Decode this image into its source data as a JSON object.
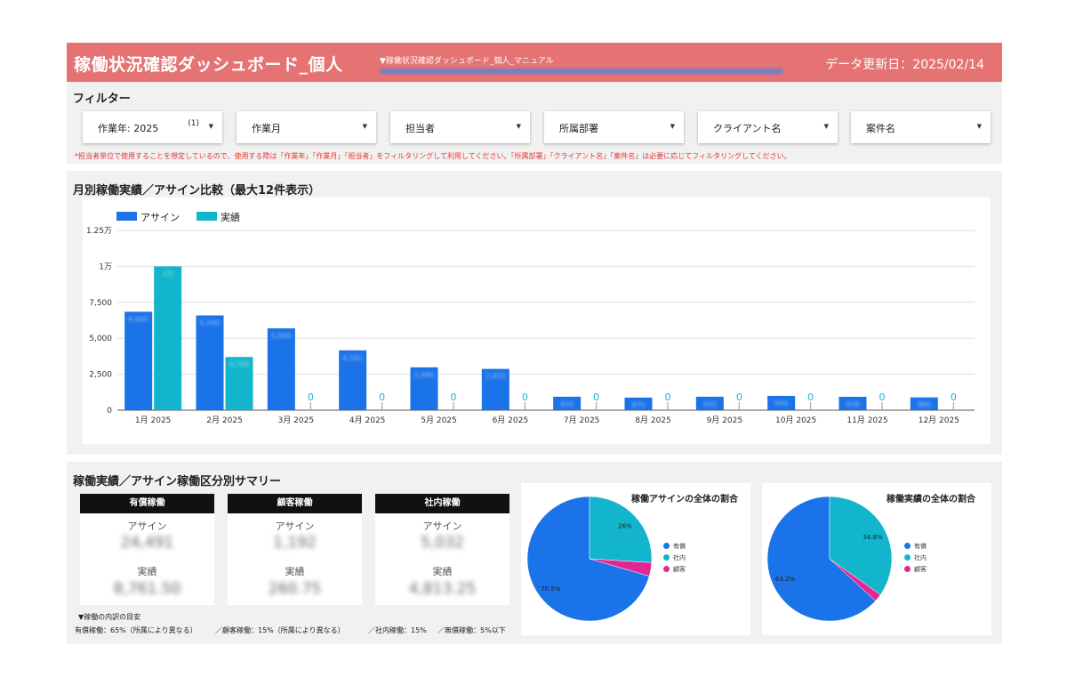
{
  "header": {
    "title": "稼働状況確認ダッシュボード_個人",
    "manual_label": "▼稼働状況確認ダッシュボード_個人_マニュアル",
    "update_date": "データ更新日：2025/02/14"
  },
  "filters": {
    "title": "フィルター",
    "items": [
      {
        "label": "作業年: 2025",
        "count": "(1)"
      },
      {
        "label": "作業月",
        "count": ""
      },
      {
        "label": "担当者",
        "count": ""
      },
      {
        "label": "所属部署",
        "count": ""
      },
      {
        "label": "クライアント名",
        "count": ""
      },
      {
        "label": "案件名",
        "count": ""
      }
    ],
    "notice": "*担当者単位で使用することを想定しているので、使用する際は「作業年」「作業月」「担当者」をフィルタリングして利用してください。「所属部署」「クライアント名」「案件名」は必要に応じてフィルタリングしてください。"
  },
  "bar_section_title": "月別稼働実績／アサイン比較（最大12件表示）",
  "summary_section_title": "稼働実績／アサイン稼働区分別サマリー",
  "kpis": [
    {
      "title": "有償稼働",
      "assign_label": "アサイン",
      "assign_value": "24,491",
      "actual_label": "実績",
      "actual_value": "8,761.50"
    },
    {
      "title": "顧客稼働",
      "assign_label": "アサイン",
      "assign_value": "1,192",
      "actual_label": "実績",
      "actual_value": "260.75"
    },
    {
      "title": "社内稼働",
      "assign_label": "アサイン",
      "assign_value": "5,032",
      "actual_label": "実績",
      "actual_value": "4,813.25"
    }
  ],
  "notes": {
    "title": "▼稼働の内訳の目安",
    "paid": "有償稼働：65%（所属により異なる）",
    "client": "／顧客稼働：15%（所属により異なる）",
    "internal": "／社内稼働：15%",
    "unpaid": "／無償稼働：5%以下"
  },
  "colors": {
    "header_bg": "#e57373",
    "assign": "#1a73e8",
    "actual": "#12b5cb",
    "client": "#e52592",
    "notice": "#e53935"
  },
  "chart_data": [
    {
      "type": "bar",
      "categories": [
        "1月 2025",
        "2月 2025",
        "3月 2025",
        "4月 2025",
        "5月 2025",
        "6月 2025",
        "7月 2025",
        "8月 2025",
        "9月 2025",
        "10月 2025",
        "11月 2025",
        "12月 2025"
      ],
      "series": [
        {
          "name": "アサイン",
          "values": [
            6845,
            6590,
            5690,
            4161,
            2980,
            2870,
            935,
            875,
            935,
            994,
            929,
            889
          ]
        },
        {
          "name": "実績",
          "values": [
            10000,
            3700,
            0,
            0,
            0,
            0,
            0,
            0,
            0,
            0,
            0,
            0
          ]
        }
      ],
      "value_labels": [
        [
          "6,845",
          "6,590",
          "5,690",
          "4,161",
          "2,980",
          "2,870",
          "935",
          "875",
          "935",
          "994",
          "929",
          "889"
        ],
        [
          "1万",
          "3,700",
          "0",
          "0",
          "0",
          "0",
          "0",
          "0",
          "0",
          "0",
          "0",
          "0"
        ]
      ],
      "ylim": [
        0,
        12500
      ],
      "yticks": [
        0,
        2500,
        5000,
        7500,
        10000,
        12500
      ],
      "ytick_labels": [
        "0",
        "2,500",
        "5,000",
        "7,500",
        "1万",
        "1.25万"
      ],
      "legend_position": "top-left",
      "grid": true
    },
    {
      "type": "pie",
      "title": "稼働アサインの全体の割合",
      "labels": [
        "有償",
        "社内",
        "顧客"
      ],
      "values": [
        70.5,
        26.0,
        3.5
      ],
      "value_labels": [
        "70.5%",
        "26%",
        ""
      ],
      "legend_position": "right"
    },
    {
      "type": "pie",
      "title": "稼働実績の全体の割合",
      "labels": [
        "有償",
        "社内",
        "顧客"
      ],
      "values": [
        63.2,
        34.8,
        2.0
      ],
      "value_labels": [
        "63.2%",
        "34.8%",
        ""
      ],
      "legend_position": "right"
    }
  ]
}
